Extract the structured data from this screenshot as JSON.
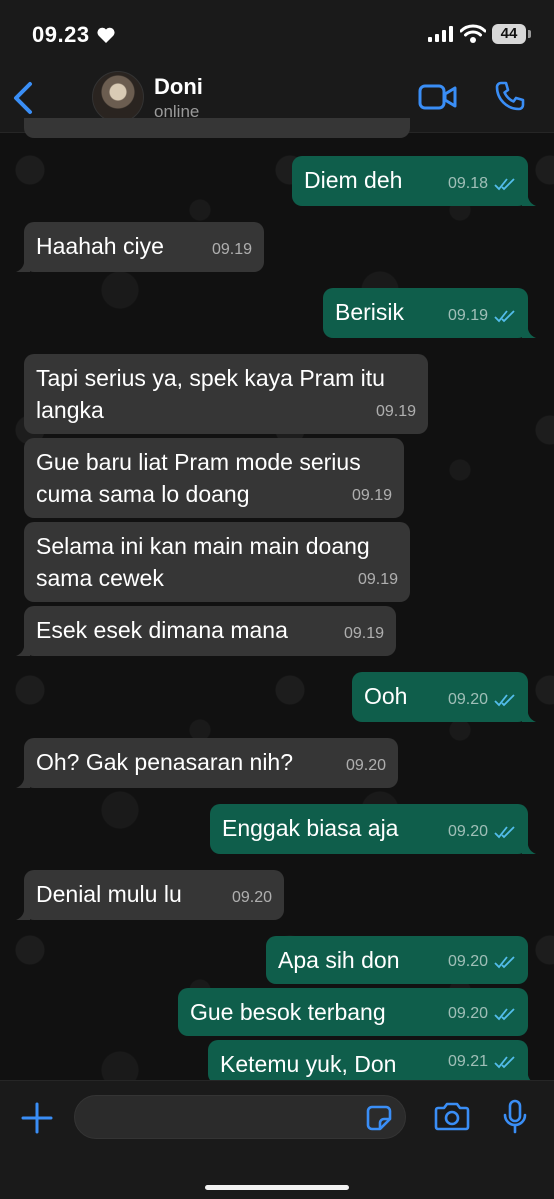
{
  "status_bar": {
    "time": "09.23",
    "battery": "44"
  },
  "header": {
    "contact_name": "Doni",
    "contact_status": "online"
  },
  "colors": {
    "accent": "#3a8ef6",
    "incoming_bubble": "#363636",
    "outgoing_bubble": "#0f5e4b",
    "read_tick": "#53bdeb"
  },
  "messages": [
    {
      "dir": "out",
      "text": "Diem deh",
      "time": "09.18",
      "read": true
    },
    {
      "dir": "in",
      "text": "Haahah ciye",
      "time": "09.19"
    },
    {
      "dir": "out",
      "text": "Berisik",
      "time": "09.19",
      "read": true
    },
    {
      "dir": "in",
      "text": "Tapi serius ya, spek kaya Pram itu\nlangka",
      "time": "09.19"
    },
    {
      "dir": "in",
      "text": "Gue baru liat Pram mode serius\ncuma sama lo doang",
      "time": "09.19"
    },
    {
      "dir": "in",
      "text": "Selama ini kan main main doang\nsama cewek",
      "time": "09.19"
    },
    {
      "dir": "in",
      "text": "Esek esek dimana mana",
      "time": "09.19"
    },
    {
      "dir": "out",
      "text": "Ooh",
      "time": "09.20",
      "read": true
    },
    {
      "dir": "in",
      "text": "Oh? Gak penasaran nih?",
      "time": "09.20"
    },
    {
      "dir": "out",
      "text": "Enggak biasa aja",
      "time": "09.20",
      "read": true
    },
    {
      "dir": "in",
      "text": "Denial mulu lu",
      "time": "09.20"
    },
    {
      "dir": "out",
      "text": "Apa sih don",
      "time": "09.20",
      "read": true
    },
    {
      "dir": "out",
      "text": "Gue besok terbang",
      "time": "09.20",
      "read": true
    },
    {
      "dir": "out",
      "text": "Ketemu yuk, Don",
      "time": "09.21",
      "read": true
    }
  ],
  "input": {
    "placeholder": ""
  }
}
